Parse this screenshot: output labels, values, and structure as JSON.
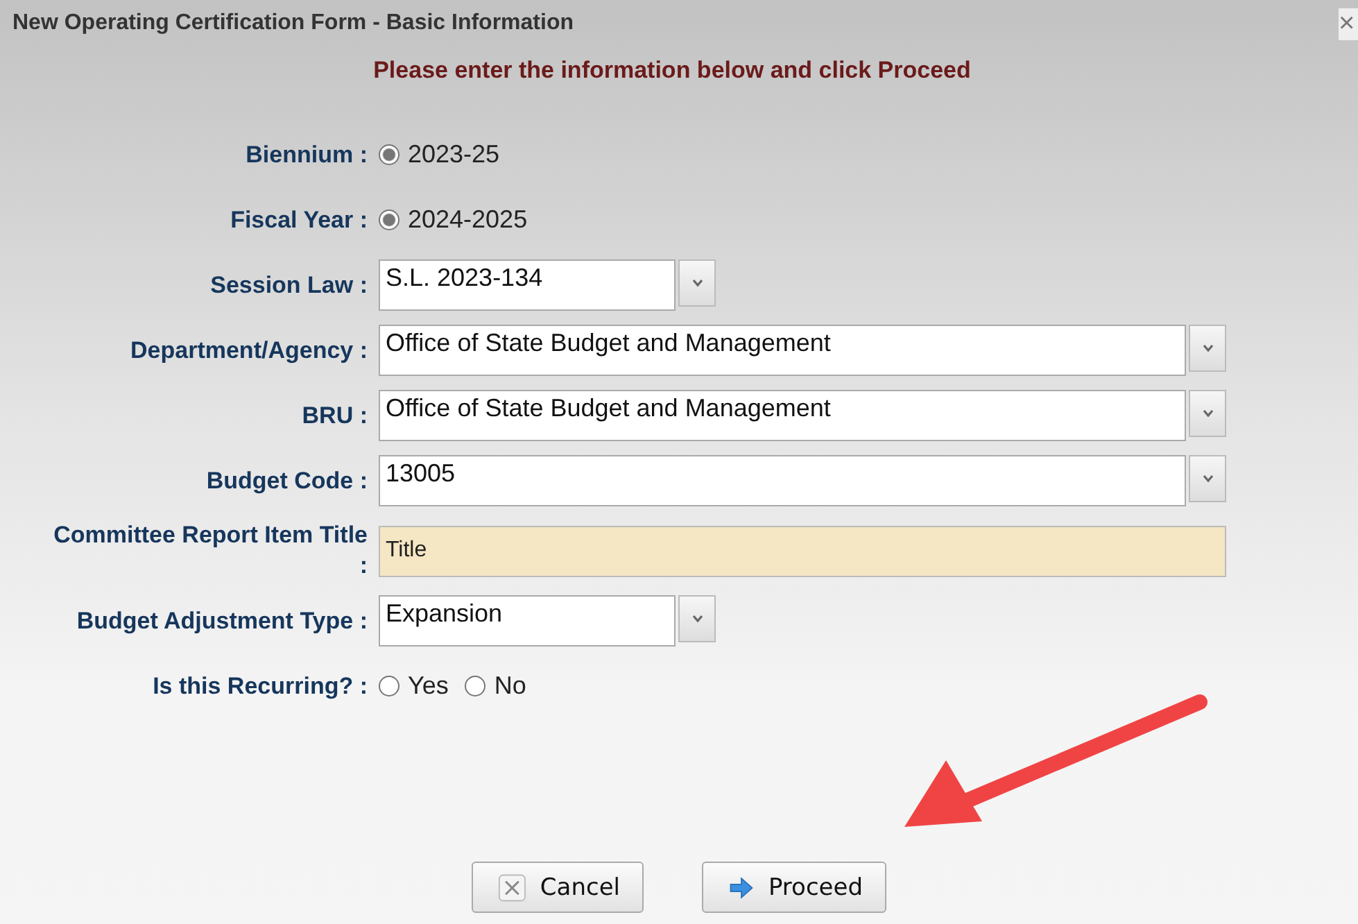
{
  "window": {
    "title": "New Operating Certification Form - Basic Information",
    "close": "×"
  },
  "instruction": "Please enter the information below and click Proceed",
  "fields": [
    {
      "kind": "radio",
      "label": "Biennium :",
      "options": [
        {
          "label": "2023-25",
          "selected": true
        }
      ]
    },
    {
      "kind": "radio",
      "label": "Fiscal Year :",
      "options": [
        {
          "label": "2024-2025",
          "selected": true
        }
      ]
    },
    {
      "kind": "select",
      "label": "Session Law :",
      "value": "S.L. 2023-134"
    },
    {
      "kind": "wideselect",
      "label": "Department/Agency :",
      "value": "Office of State Budget and Management"
    },
    {
      "kind": "wideselect",
      "label": "BRU :",
      "value": "Office of State Budget and Management"
    },
    {
      "kind": "wideselect",
      "label": "Budget Code :",
      "value": "13005"
    },
    {
      "kind": "text",
      "label": "Committee Report Item Title :",
      "placeholder": "Title"
    },
    {
      "kind": "select",
      "label": "Budget Adjustment Type :",
      "value": "Expansion"
    },
    {
      "kind": "radio",
      "label": "Is this Recurring? :",
      "options": [
        {
          "label": "Yes",
          "selected": false
        },
        {
          "label": "No",
          "selected": false
        }
      ]
    }
  ],
  "buttons": [
    {
      "kind": "cancel",
      "label": "Cancel"
    },
    {
      "kind": "proceed",
      "label": "Proceed"
    }
  ]
}
